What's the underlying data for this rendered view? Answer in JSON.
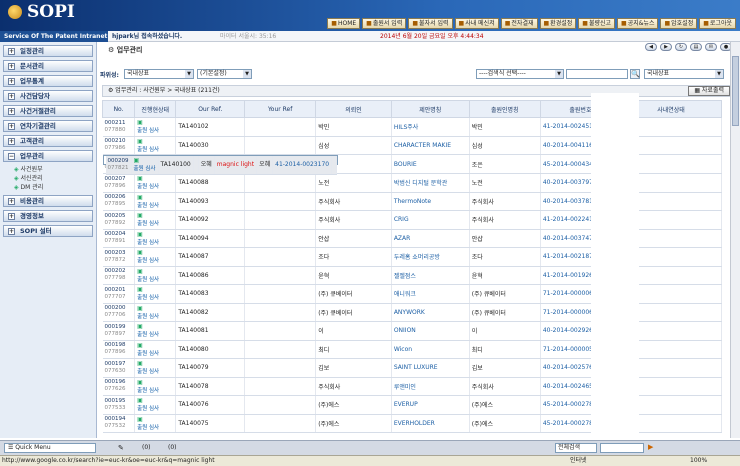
{
  "app": {
    "logo": "SOPI",
    "service": "Service Of The Patent Intranet"
  },
  "topmenu": [
    {
      "icon": "home-icon",
      "label": "HOME"
    },
    {
      "icon": "input-icon",
      "label": "출원서 입력"
    },
    {
      "icon": "input-icon",
      "label": "불자서 입력"
    },
    {
      "icon": "mail-icon",
      "label": "사내 메신저"
    },
    {
      "icon": "board-icon",
      "label": "전자결재"
    },
    {
      "icon": "gear-icon",
      "label": "환경설정"
    },
    {
      "icon": "report-icon",
      "label": "불량신고"
    },
    {
      "icon": "share-icon",
      "label": "공지&뉴스"
    },
    {
      "icon": "gear-icon",
      "label": "암호설정"
    },
    {
      "icon": "logout-icon",
      "label": "로그아웃"
    }
  ],
  "infobar": {
    "user": "hjpark님 접속하셨습니다.",
    "extra": "마이터 서울시: 35:16",
    "date": "2014년 6월 20일 금요일 오후 4:44:34"
  },
  "sidebar": {
    "items": [
      {
        "label": "일정관리"
      },
      {
        "label": "문서관리"
      },
      {
        "label": "업무통계"
      },
      {
        "label": "사건담당자"
      },
      {
        "label": "사건거절관리"
      },
      {
        "label": "연차기결관리"
      },
      {
        "label": "고객관리"
      },
      {
        "label": "업무관리"
      }
    ],
    "sub": [
      "사건원부",
      "서신관리",
      "DM 관리"
    ],
    "items2": [
      {
        "label": "비용관리"
      },
      {
        "label": "경영정보"
      },
      {
        "label": "SOPI 설터"
      }
    ]
  },
  "main": {
    "title": "업무관리",
    "filter_label": "파위성:",
    "type_select": "국내상표",
    "default_select": "(기본설정)",
    "search_select": "----검색식 선택----",
    "search_value": "",
    "right_select": "국내상표",
    "crumb": "업무관리 : 사건원부 > 국내상표 (211건)",
    "excel_btn": "자료출력"
  },
  "columns": [
    "No.",
    "진행현상태",
    "Our Ref.",
    "Your Ref",
    "의뢰인",
    "제안명칭",
    "출원인명칭",
    "출원번호",
    "사내연상태"
  ],
  "rows": [
    {
      "no": "000211",
      "sub": "077880",
      "status": "출원 심사",
      "ref": "TA140102",
      "client": "박민",
      "mark": "HILS주사",
      "applicant": "박민",
      "appno": "41-2014-0024516"
    },
    {
      "no": "000210",
      "sub": "077986",
      "status": "출원 심사",
      "ref": "TA140030",
      "client": "심성",
      "mark": "CHARACTER MAKIE",
      "applicant": "심성",
      "appno": "40-2014-0041168"
    },
    {
      "no": "000209",
      "sub": "077821",
      "status": "출원 심사",
      "ref": "TA140100",
      "client": "오혜",
      "mark": "magnic light",
      "applicant": "오혜",
      "appno": "41-2014-0023170"
    },
    {
      "no": "000208",
      "sub": "077897",
      "status": "출원 심사",
      "ref": "TA140090",
      "client": "조은",
      "mark": "BOURIE",
      "applicant": "조은",
      "appno": "45-2014-0004341"
    },
    {
      "no": "000207",
      "sub": "077896",
      "status": "출원 심사",
      "ref": "TA140088",
      "client": "노전",
      "mark": "박범신 디지털 문학관",
      "applicant": "노전",
      "appno": "40-2014-0037974"
    },
    {
      "no": "000206",
      "sub": "077895",
      "status": "출원 심사",
      "ref": "TA140093",
      "client": "주식회사",
      "mark": "ThermoNote",
      "applicant": "주식회사",
      "appno": "40-2014-0037816"
    },
    {
      "no": "000205",
      "sub": "077892",
      "status": "출원 심사",
      "ref": "TA140092",
      "client": "주식회사",
      "mark": "CRIG",
      "applicant": "주식회사",
      "appno": "41-2014-0022413"
    },
    {
      "no": "000204",
      "sub": "077891",
      "status": "출원 심사",
      "ref": "TA140094",
      "client": "안샵",
      "mark": "AZAR",
      "applicant": "안샵",
      "appno": "40-2014-0037472"
    },
    {
      "no": "000203",
      "sub": "077872",
      "status": "출원 심사",
      "ref": "TA140087",
      "client": "조다",
      "mark": "두레홈 쇼머리공방",
      "applicant": "조다",
      "appno": "41-2014-0021879"
    },
    {
      "no": "000202",
      "sub": "077798",
      "status": "출원 심사",
      "ref": "TA140086",
      "client": "윤혁",
      "mark": "젤젤점스",
      "applicant": "윤혁",
      "appno": "41-2014-0019265"
    },
    {
      "no": "000201",
      "sub": "077707",
      "status": "출원 심사",
      "ref": "TA140083",
      "client": "(주) 큐베이터",
      "mark": "애니워크",
      "applicant": "(주) 큐베이터",
      "appno": "71-2014-0000069"
    },
    {
      "no": "000200",
      "sub": "077706",
      "status": "출원 심사",
      "ref": "TA140082",
      "client": "(주) 큐베이터",
      "mark": "ANYWORK",
      "applicant": "(주) 큐베이터",
      "appno": "71-2014-0000068"
    },
    {
      "no": "000199",
      "sub": "077897",
      "status": "출원 심사",
      "ref": "TA140081",
      "client": "이",
      "mark": "ONIION",
      "applicant": "이",
      "appno": "40-2014-0029267"
    },
    {
      "no": "000198",
      "sub": "077896",
      "status": "출원 심사",
      "ref": "TA140080",
      "client": "최디",
      "mark": "Wicon",
      "applicant": "최디",
      "appno": "71-2014-0000058"
    },
    {
      "no": "000197",
      "sub": "077630",
      "status": "출원 심사",
      "ref": "TA140079",
      "client": "김보",
      "mark": "SAINT LUXURE",
      "applicant": "김보",
      "appno": "40-2014-0025761"
    },
    {
      "no": "000196",
      "sub": "077626",
      "status": "출원 심사",
      "ref": "TA140078",
      "client": "주식회사",
      "mark": "루앤미인",
      "applicant": "주식회사",
      "appno": "40-2014-0024656"
    },
    {
      "no": "000195",
      "sub": "077533",
      "status": "출원 심사",
      "ref": "TA140076",
      "client": "(주)에스",
      "mark": "EVERUP",
      "applicant": "(주)에스",
      "appno": "45-2014-0002788"
    },
    {
      "no": "000194",
      "sub": "077532",
      "status": "출원 심사",
      "ref": "TA140075",
      "client": "(주)에스",
      "mark": "EVERHOLDER",
      "applicant": "(주)에스",
      "appno": "45-2014-0002787"
    }
  ],
  "bottom": {
    "quickmenu": "Quick Menu",
    "count1": "(0)",
    "count2": "(0)",
    "right_select": "전체검색"
  },
  "status": {
    "url": "http://www.google.co.kr/search?ie=euc-kr&oe=euc-kr&q=magnic light",
    "zone": "인터넷",
    "zoom": "100%"
  }
}
